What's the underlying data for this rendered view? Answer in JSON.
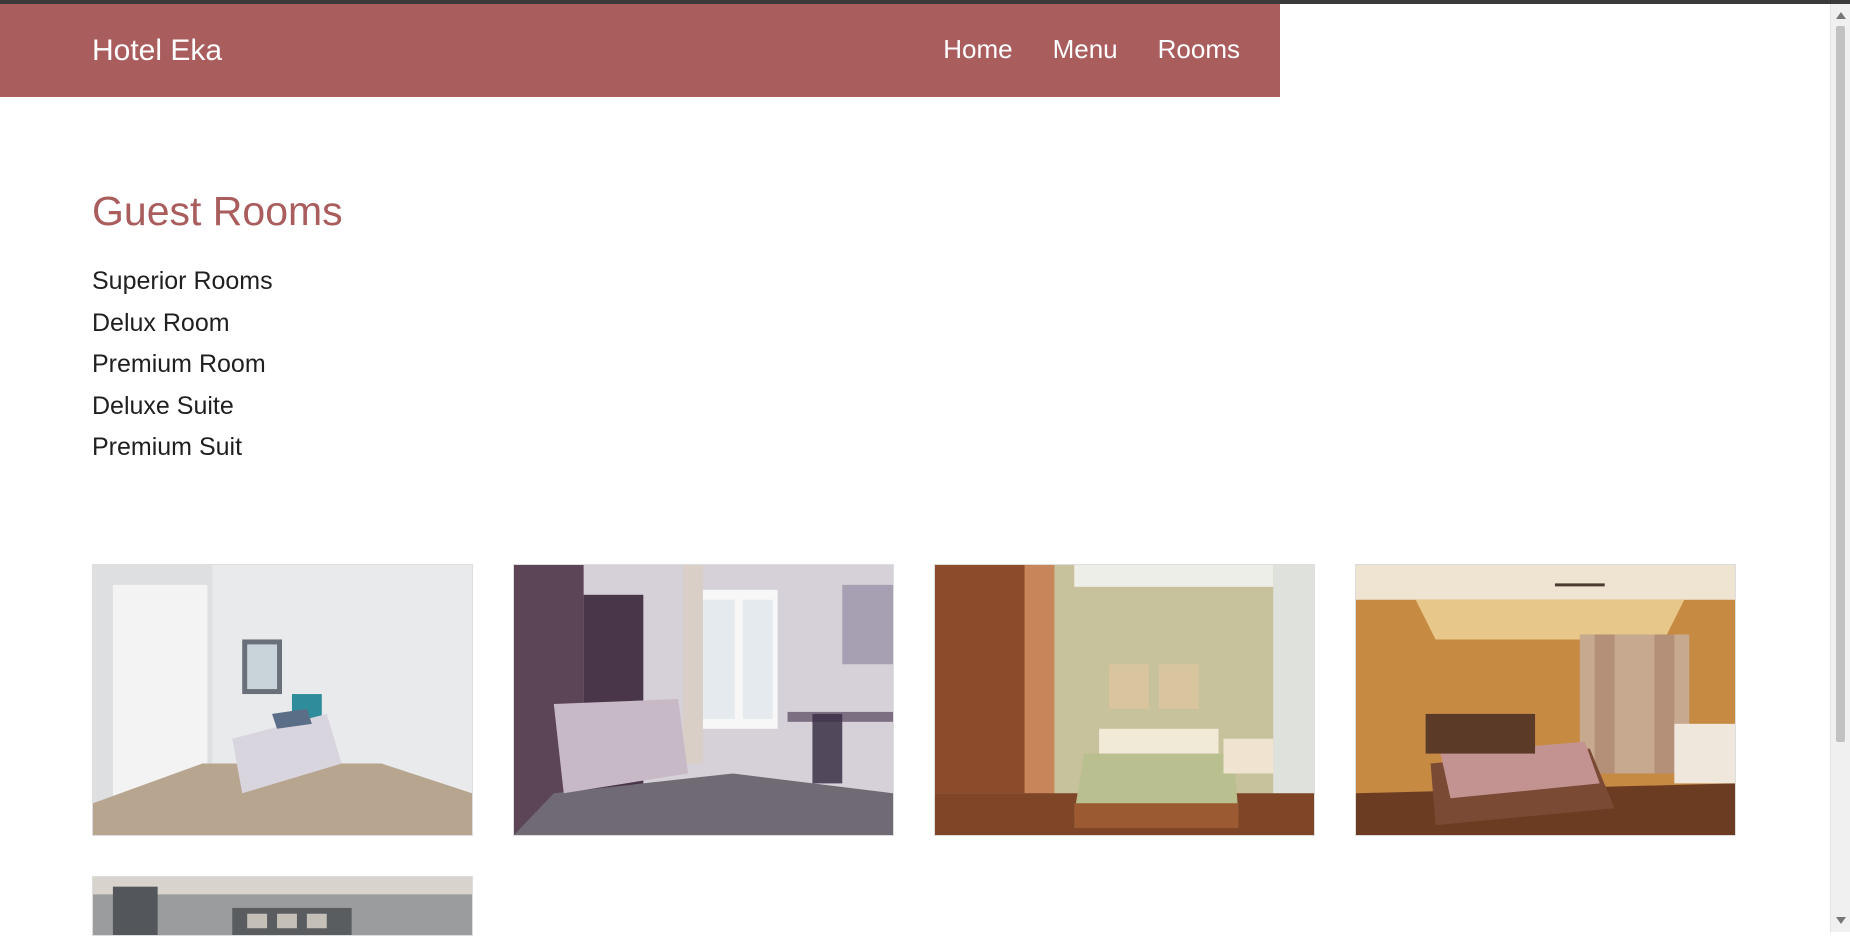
{
  "navbar": {
    "brand": "Hotel Eka",
    "links": [
      {
        "label": "Home"
      },
      {
        "label": "Menu"
      },
      {
        "label": "Rooms"
      }
    ]
  },
  "main": {
    "title": "Guest Rooms",
    "rooms": [
      "Superior Rooms",
      "Delux Room",
      "Premium Room",
      "Deluxe Suite",
      "Premium Suit"
    ]
  },
  "colors": {
    "brand": "#a95d5d"
  }
}
